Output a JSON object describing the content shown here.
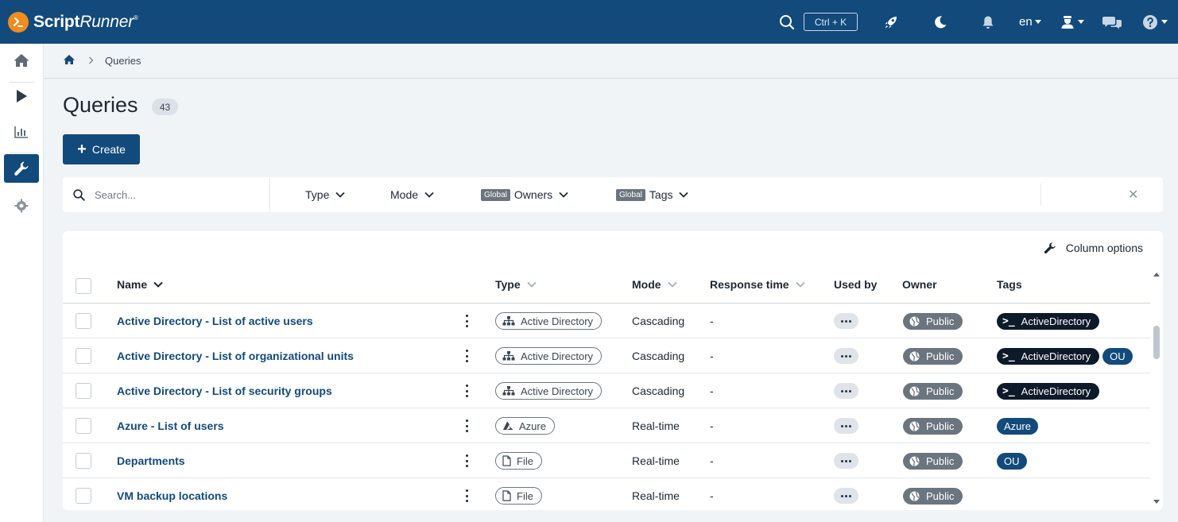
{
  "app": {
    "logo_bold": "Script",
    "logo_italic": "Runner",
    "logo_reg": "®"
  },
  "topbar": {
    "shortcut": "Ctrl + K",
    "language": "en",
    "icons": [
      "search-icon",
      "rocket-icon",
      "moon-icon",
      "bell-icon",
      "user-icon",
      "chat-icon",
      "help-icon"
    ]
  },
  "sidebar": {
    "items": [
      {
        "name": "home",
        "icon": "home-icon"
      },
      {
        "name": "run",
        "icon": "play-icon"
      },
      {
        "name": "reports",
        "icon": "chart-icon"
      },
      {
        "name": "configuration",
        "icon": "wrench-icon",
        "active": true
      },
      {
        "name": "settings",
        "icon": "gear-icon"
      }
    ]
  },
  "breadcrumb": {
    "current": "Queries"
  },
  "page": {
    "title": "Queries",
    "count": "43",
    "create_label": "Create"
  },
  "filters": {
    "search_placeholder": "Search...",
    "type_label": "Type",
    "mode_label": "Mode",
    "global_badge": "Global",
    "owners_label": "Owners",
    "tags_label": "Tags",
    "clear_symbol": "✕"
  },
  "table": {
    "column_options": "Column options",
    "columns": {
      "name": "Name",
      "type": "Type",
      "mode": "Mode",
      "response_time": "Response time",
      "used_by": "Used by",
      "owner": "Owner",
      "tags": "Tags"
    },
    "rows": [
      {
        "name": "Active Directory - List of active users",
        "type": "Active Directory",
        "type_icon": "sitemap-icon",
        "mode": "Cascading",
        "response_time": "-",
        "owner": "Public",
        "tags": [
          {
            "label": "ActiveDirectory",
            "style": "dark"
          }
        ]
      },
      {
        "name": "Active Directory - List of organizational units",
        "type": "Active Directory",
        "type_icon": "sitemap-icon",
        "mode": "Cascading",
        "response_time": "-",
        "owner": "Public",
        "tags": [
          {
            "label": "ActiveDirectory",
            "style": "dark"
          },
          {
            "label": "OU",
            "style": "blue"
          }
        ]
      },
      {
        "name": "Active Directory - List of security groups",
        "type": "Active Directory",
        "type_icon": "sitemap-icon",
        "mode": "Cascading",
        "response_time": "-",
        "owner": "Public",
        "tags": [
          {
            "label": "ActiveDirectory",
            "style": "dark"
          }
        ]
      },
      {
        "name": "Azure - List of users",
        "type": "Azure",
        "type_icon": "azure-icon",
        "mode": "Real-time",
        "response_time": "-",
        "owner": "Public",
        "tags": [
          {
            "label": "Azure",
            "style": "blue"
          }
        ]
      },
      {
        "name": "Departments",
        "type": "File",
        "type_icon": "file-icon",
        "mode": "Real-time",
        "response_time": "-",
        "owner": "Public",
        "tags": [
          {
            "label": "OU",
            "style": "blue"
          }
        ]
      },
      {
        "name": "VM backup locations",
        "type": "File",
        "type_icon": "file-icon",
        "mode": "Real-time",
        "response_time": "-",
        "owner": "Public",
        "tags": []
      }
    ]
  },
  "colors": {
    "primary": "#124a7c",
    "accent": "#f28c1c",
    "tag_dark": "#0d1a2a",
    "badge_gray": "#6b7580"
  }
}
